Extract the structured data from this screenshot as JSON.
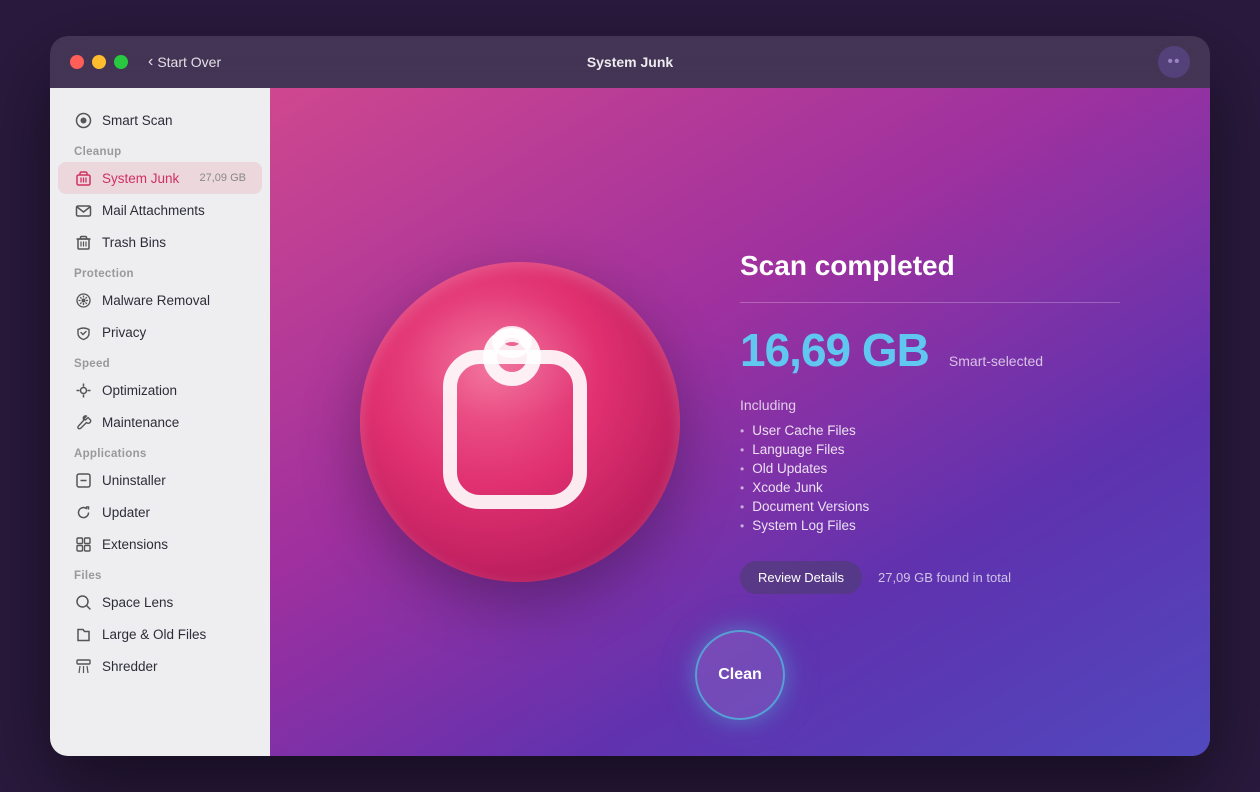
{
  "window": {
    "title": "System Junk"
  },
  "titlebar": {
    "back_label": "Start Over",
    "title": "System Junk"
  },
  "sidebar": {
    "smart_scan": "Smart Scan",
    "sections": [
      {
        "label": "Cleanup",
        "items": [
          {
            "id": "system-junk",
            "label": "System Junk",
            "badge": "27,09 GB",
            "active": true
          },
          {
            "id": "mail-attachments",
            "label": "Mail Attachments",
            "badge": "",
            "active": false
          },
          {
            "id": "trash-bins",
            "label": "Trash Bins",
            "badge": "",
            "active": false
          }
        ]
      },
      {
        "label": "Protection",
        "items": [
          {
            "id": "malware-removal",
            "label": "Malware Removal",
            "badge": "",
            "active": false
          },
          {
            "id": "privacy",
            "label": "Privacy",
            "badge": "",
            "active": false
          }
        ]
      },
      {
        "label": "Speed",
        "items": [
          {
            "id": "optimization",
            "label": "Optimization",
            "badge": "",
            "active": false
          },
          {
            "id": "maintenance",
            "label": "Maintenance",
            "badge": "",
            "active": false
          }
        ]
      },
      {
        "label": "Applications",
        "items": [
          {
            "id": "uninstaller",
            "label": "Uninstaller",
            "badge": "",
            "active": false
          },
          {
            "id": "updater",
            "label": "Updater",
            "badge": "",
            "active": false
          },
          {
            "id": "extensions",
            "label": "Extensions",
            "badge": "",
            "active": false
          }
        ]
      },
      {
        "label": "Files",
        "items": [
          {
            "id": "space-lens",
            "label": "Space Lens",
            "badge": "",
            "active": false
          },
          {
            "id": "large-old-files",
            "label": "Large & Old Files",
            "badge": "",
            "active": false
          },
          {
            "id": "shredder",
            "label": "Shredder",
            "badge": "",
            "active": false
          }
        ]
      }
    ]
  },
  "main": {
    "scan_title": "Scan completed",
    "size_value": "16,69 GB",
    "smart_selected": "Smart-selected",
    "including_label": "Including",
    "file_items": [
      "User Cache Files",
      "Language Files",
      "Old Updates",
      "Xcode Junk",
      "Document Versions",
      "System Log Files"
    ],
    "review_btn_label": "Review Details",
    "found_total": "27,09 GB found in total",
    "clean_btn_label": "Clean"
  },
  "icons": {
    "smart_scan": "⊙",
    "system_junk": "🗂",
    "mail": "✉",
    "trash": "🗑",
    "malware": "☣",
    "privacy": "✋",
    "optimization": "⚙",
    "maintenance": "🔧",
    "uninstaller": "⊠",
    "updater": "↻",
    "extensions": "⊞",
    "space_lens": "◎",
    "large_files": "📁",
    "shredder": "▤",
    "back_chevron": "‹"
  }
}
